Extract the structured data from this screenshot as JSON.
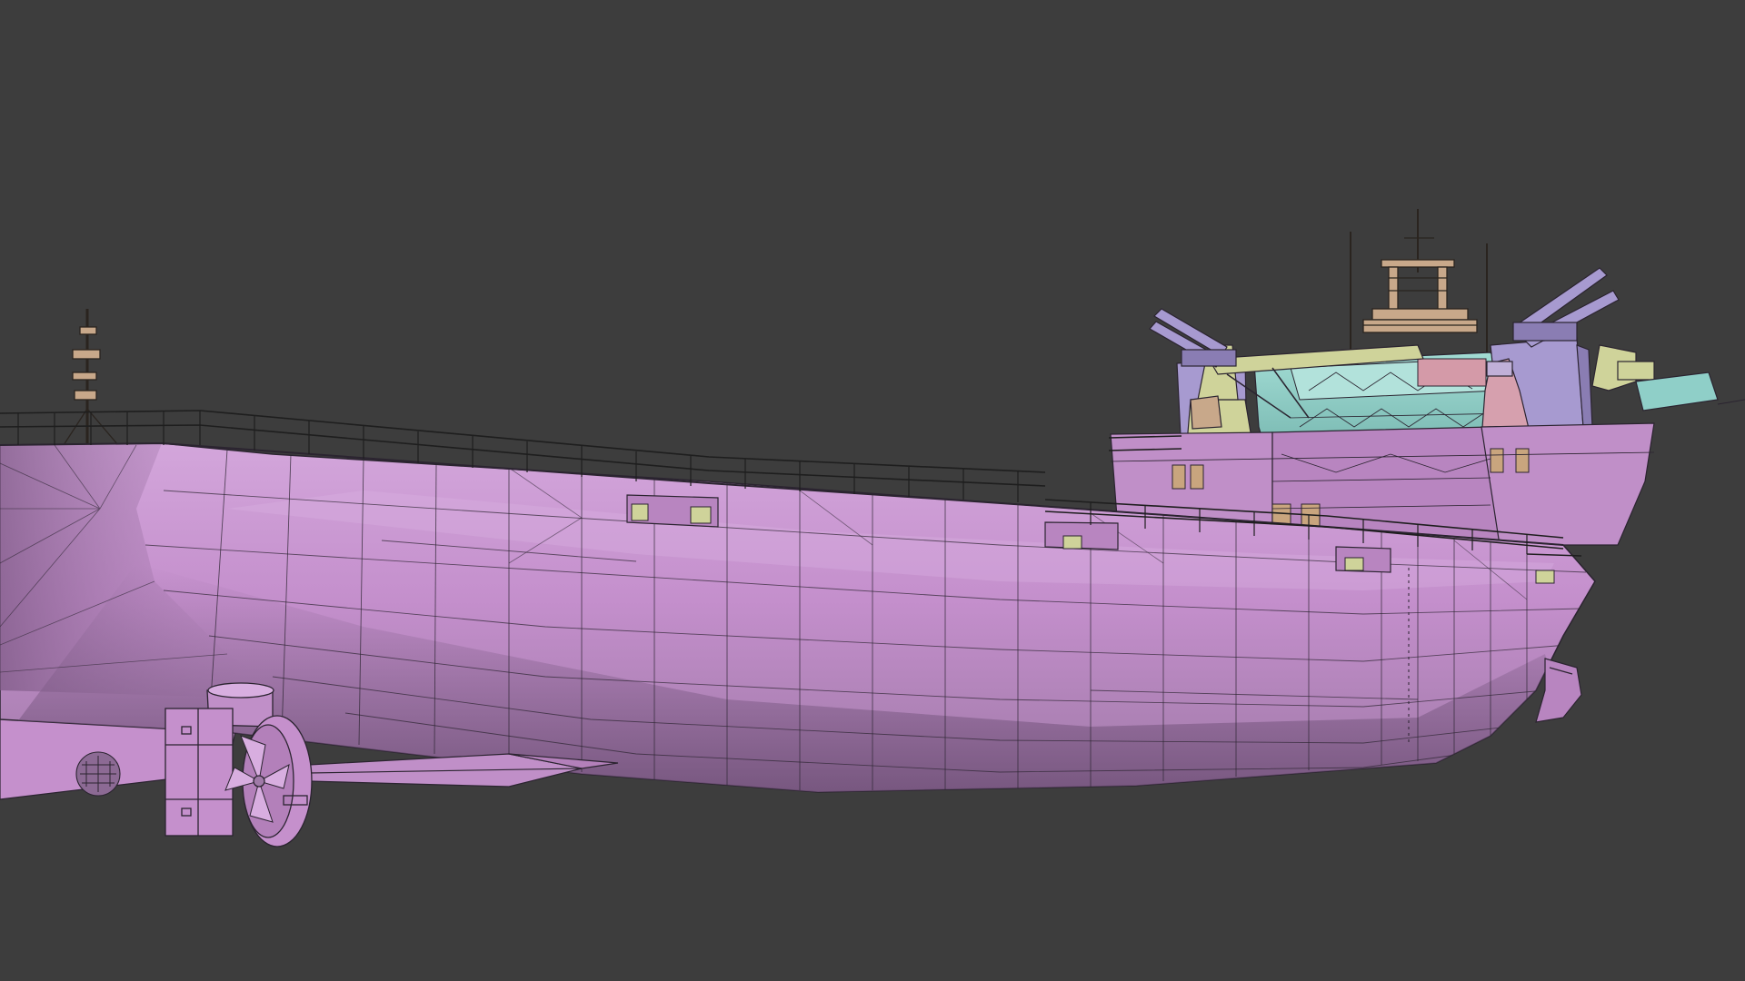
{
  "viewport": {
    "background": "#3d3d3d",
    "display_mode": "solid-with-wireframe-overlay"
  },
  "scene": {
    "subject": "cargo-ship-3d-model",
    "colors": {
      "hull": "#c08fc8",
      "hull_shade": "#7e5a86",
      "hull_light": "#d8aee0",
      "wire": "#2b2430",
      "superstructure_teal": "#8fcfc8",
      "superstructure_lavender": "#a79ad0",
      "crane_yellow": "#cfd39a",
      "mast_tan": "#c8a88a",
      "window_tan": "#c9a57e",
      "railing": "#1e1e1e"
    }
  }
}
